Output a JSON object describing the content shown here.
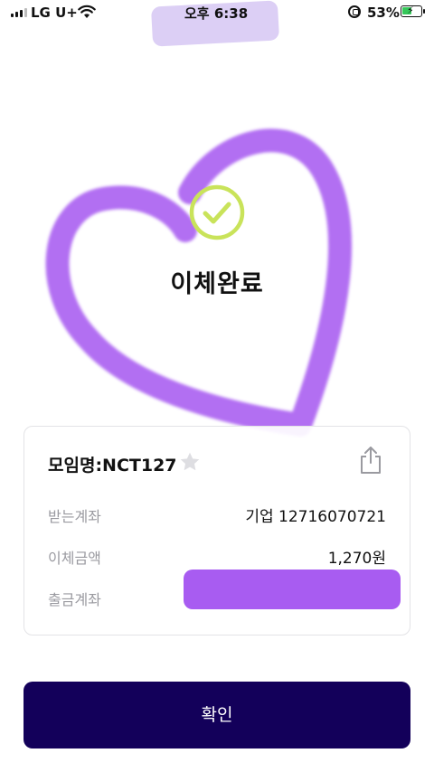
{
  "status_bar": {
    "carrier": "LG U+",
    "time": "오후 6:38",
    "battery_percent": "53%",
    "battery_level": 0.53,
    "icons": [
      "signal-icon",
      "wifi-icon",
      "orientation-lock-icon",
      "battery-charging-icon"
    ]
  },
  "result": {
    "title": "이체완료",
    "icon": "check-circle-icon",
    "accent_color": "#c9e35a",
    "decoration_color": "#a85cf1"
  },
  "details": {
    "meeting_name": "모임명:NCT127",
    "favorite_icon": "star-icon",
    "share_icon": "share-icon",
    "rows": [
      {
        "label": "받는계좌",
        "value": "기업 12716070721"
      },
      {
        "label": "이체금액",
        "value": "1,270원"
      },
      {
        "label": "출금계좌",
        "value": ""
      }
    ]
  },
  "confirm_button": {
    "label": "확인",
    "color": "#13005a"
  }
}
